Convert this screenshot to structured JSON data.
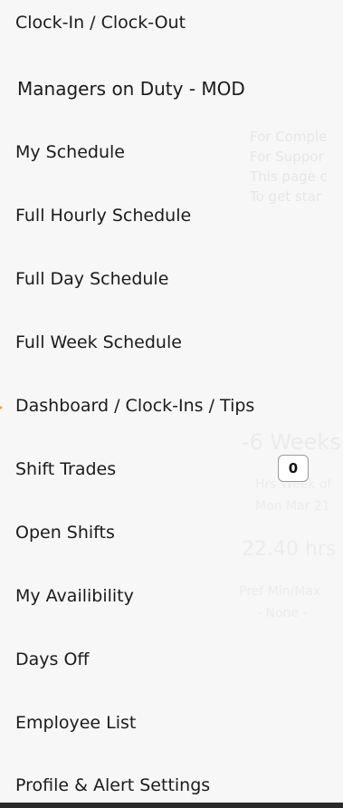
{
  "menu": {
    "items": [
      {
        "label": "Clock-In / Clock-Out"
      },
      {
        "label": "Managers on Duty - MOD"
      },
      {
        "label": "My Schedule"
      },
      {
        "label": "Full Hourly Schedule"
      },
      {
        "label": "Full Day Schedule"
      },
      {
        "label": "Full Week Schedule"
      },
      {
        "label": "Dashboard / Clock-Ins / Tips"
      },
      {
        "label": "Shift Trades",
        "badge": "0"
      },
      {
        "label": "Open Shifts"
      },
      {
        "label": "My Availibility"
      },
      {
        "label": "Days Off"
      },
      {
        "label": "Employee List"
      },
      {
        "label": "Profile & Alert Settings"
      }
    ],
    "active_index": 6,
    "active_marker_color": "#f0a030"
  },
  "background": {
    "info_lines": [
      "For Comple",
      "For Suppor",
      "This page c",
      "To get star"
    ],
    "weeks_label": "-6 Weeks",
    "hrs_week_label": "Hrs Week of",
    "week_date": "Mon Mar 21",
    "hours_value": "22.40 hrs",
    "pref_label": "Pref Min/Max",
    "pref_value": "- None -"
  }
}
